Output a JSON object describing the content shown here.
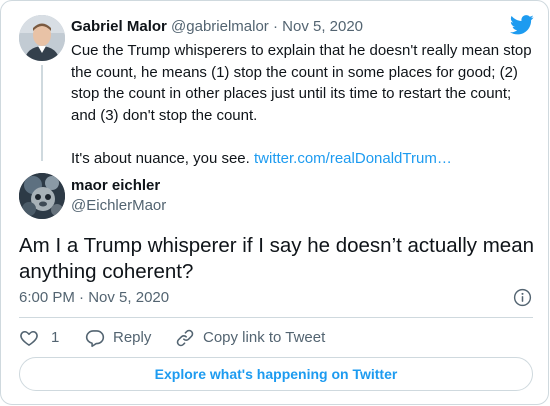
{
  "colors": {
    "text": "#0f1419",
    "secondary": "#536471",
    "link": "#1d9bf0",
    "border": "#cfd9de",
    "twitter_blue": "#1d9bf0"
  },
  "quoted_tweet": {
    "author_name": "Gabriel Malor",
    "author_handle": "@gabrielmalor",
    "separator": "·",
    "date": "Nov 5, 2020",
    "text_paragraph_1": "Cue the Trump whisperers to explain that he doesn't really mean stop the count, he means (1) stop the count in some places for good; (2) stop the count in other places just until its time to restart the count; and (3) don't stop the count.",
    "text_paragraph_2": "It's about nuance, you see.",
    "link_text": "twitter.com/realDonaldTrum…"
  },
  "main_tweet": {
    "author_name": "maor eichler",
    "author_handle": "@EichlerMaor",
    "text": "Am I a Trump whisperer if I say he doesn’t actually mean anything coherent?",
    "time": "6:00 PM",
    "separator": "·",
    "date": "Nov 5, 2020"
  },
  "actions": {
    "like_count": "1",
    "reply_label": "Reply",
    "copy_link_label": "Copy link to Tweet"
  },
  "explore_button": "Explore what's happening on Twitter",
  "icons": {
    "brand": "twitter-bird-icon",
    "info": "info-icon",
    "like": "heart-icon",
    "reply": "reply-icon",
    "copy_link": "link-icon"
  }
}
